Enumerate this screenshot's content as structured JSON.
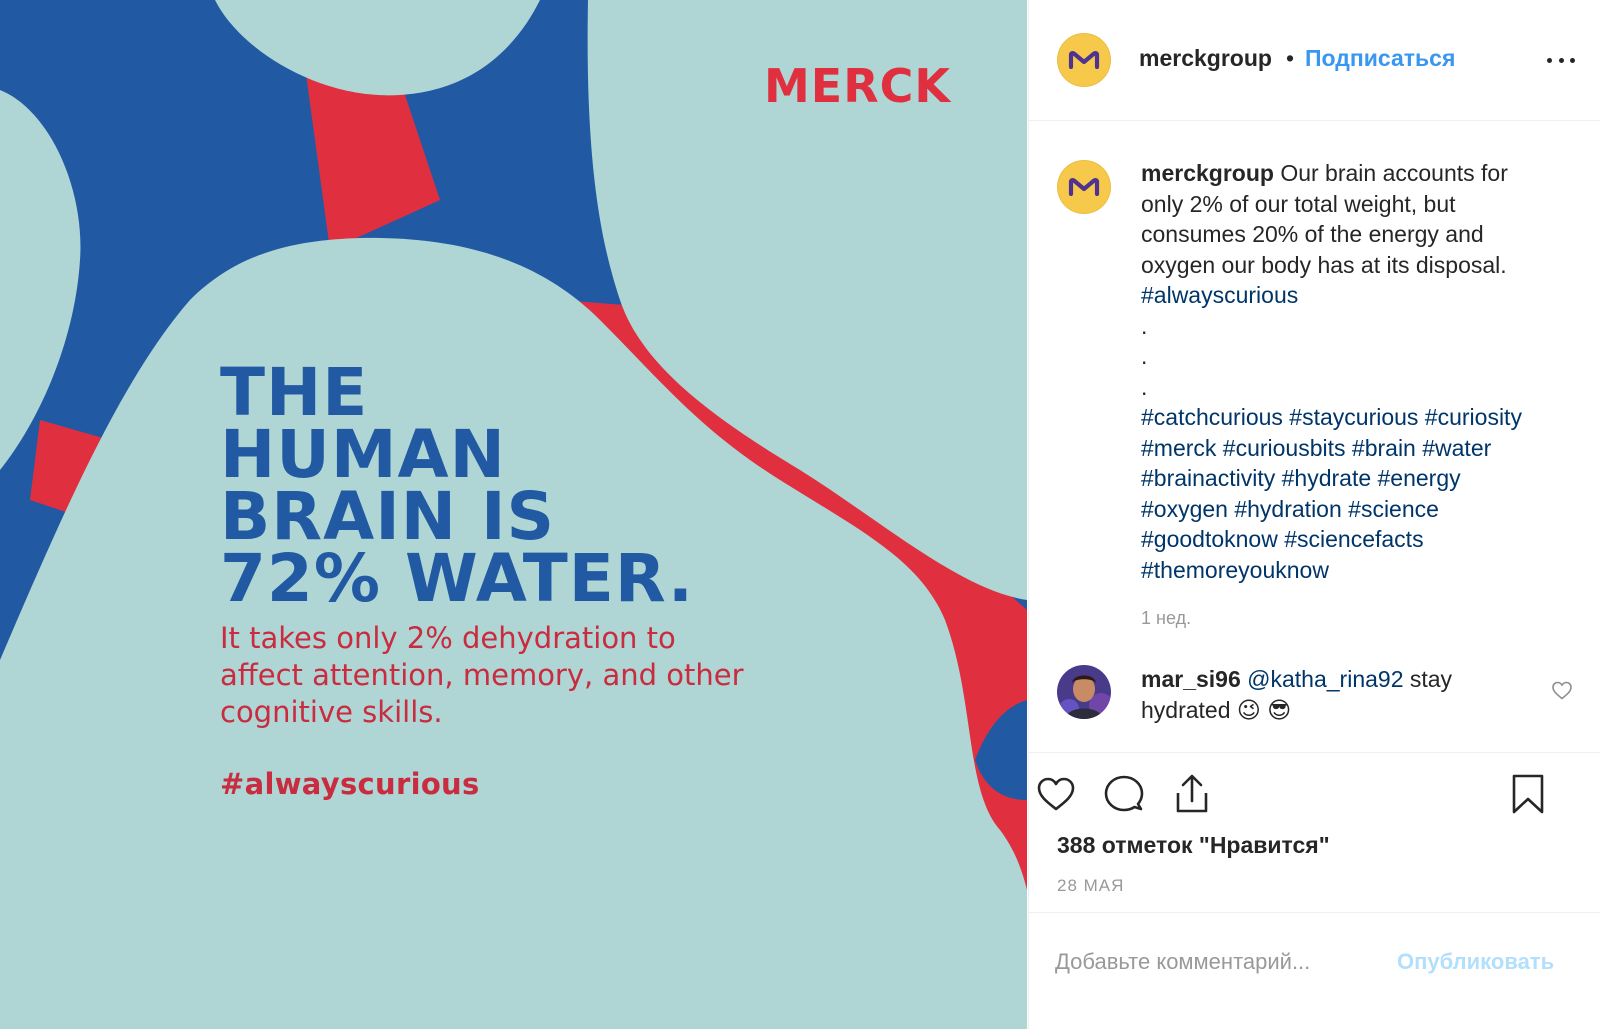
{
  "media": {
    "brand_logo": "MERCK",
    "headline_lines": [
      "The",
      "Human",
      "Brain is",
      "72% Water."
    ],
    "subtext_lines": [
      "It takes only 2% dehydration to",
      "affect attention, memory, and other",
      "cognitive skills."
    ],
    "hashtag": "#alwayscurious",
    "colors": {
      "blue": "#2159a3",
      "mint": "#afd6d5",
      "red": "#e0303f",
      "subtext_red": "#c92b3f"
    }
  },
  "header": {
    "username": "merckgroup",
    "separator": "•",
    "follow_label": "Подписаться",
    "avatar_icon": "merck-m-logo-icon",
    "more_icon": "more-options-icon"
  },
  "caption": {
    "username": "merckgroup",
    "text_lines": [
      "Our brain accounts for",
      "only 2% of our total weight, but",
      "consumes 20% of the energy and",
      "oxygen our body has at its disposal."
    ],
    "hashtag_main": "#alwayscurious",
    "dots": [
      ".",
      ".",
      "."
    ],
    "hashtag_lines": [
      "#catchcurious #staycurious #curiosity",
      "#merck #curiousbits #brain #water",
      "#brainactivity #hydrate #energy",
      "#oxygen #hydration #science",
      "#goodtoknow #sciencefacts",
      "#themoreyouknow"
    ],
    "time_ago": "1 нед."
  },
  "comment": {
    "username": "mar_si96",
    "mention": "@katha_rina92",
    "text_a": "stay",
    "text_b": "hydrated 😉 😎",
    "like_icon": "heart-outline-icon"
  },
  "actions": {
    "like_icon": "heart-icon",
    "comment_icon": "comment-bubble-icon",
    "share_icon": "share-icon",
    "save_icon": "bookmark-icon"
  },
  "likes_text": "388 отметок \"Нравится\"",
  "date_text": "28 мая",
  "comment_input": {
    "placeholder": "Добавьте комментарий...",
    "value": ""
  },
  "publish_label": "Опубликовать",
  "colors": {
    "link": "#3897f0",
    "hashtag": "#003569",
    "muted": "#999999",
    "publish_disabled": "#b2dffc",
    "avatar_yellow": "#f6c94a"
  }
}
